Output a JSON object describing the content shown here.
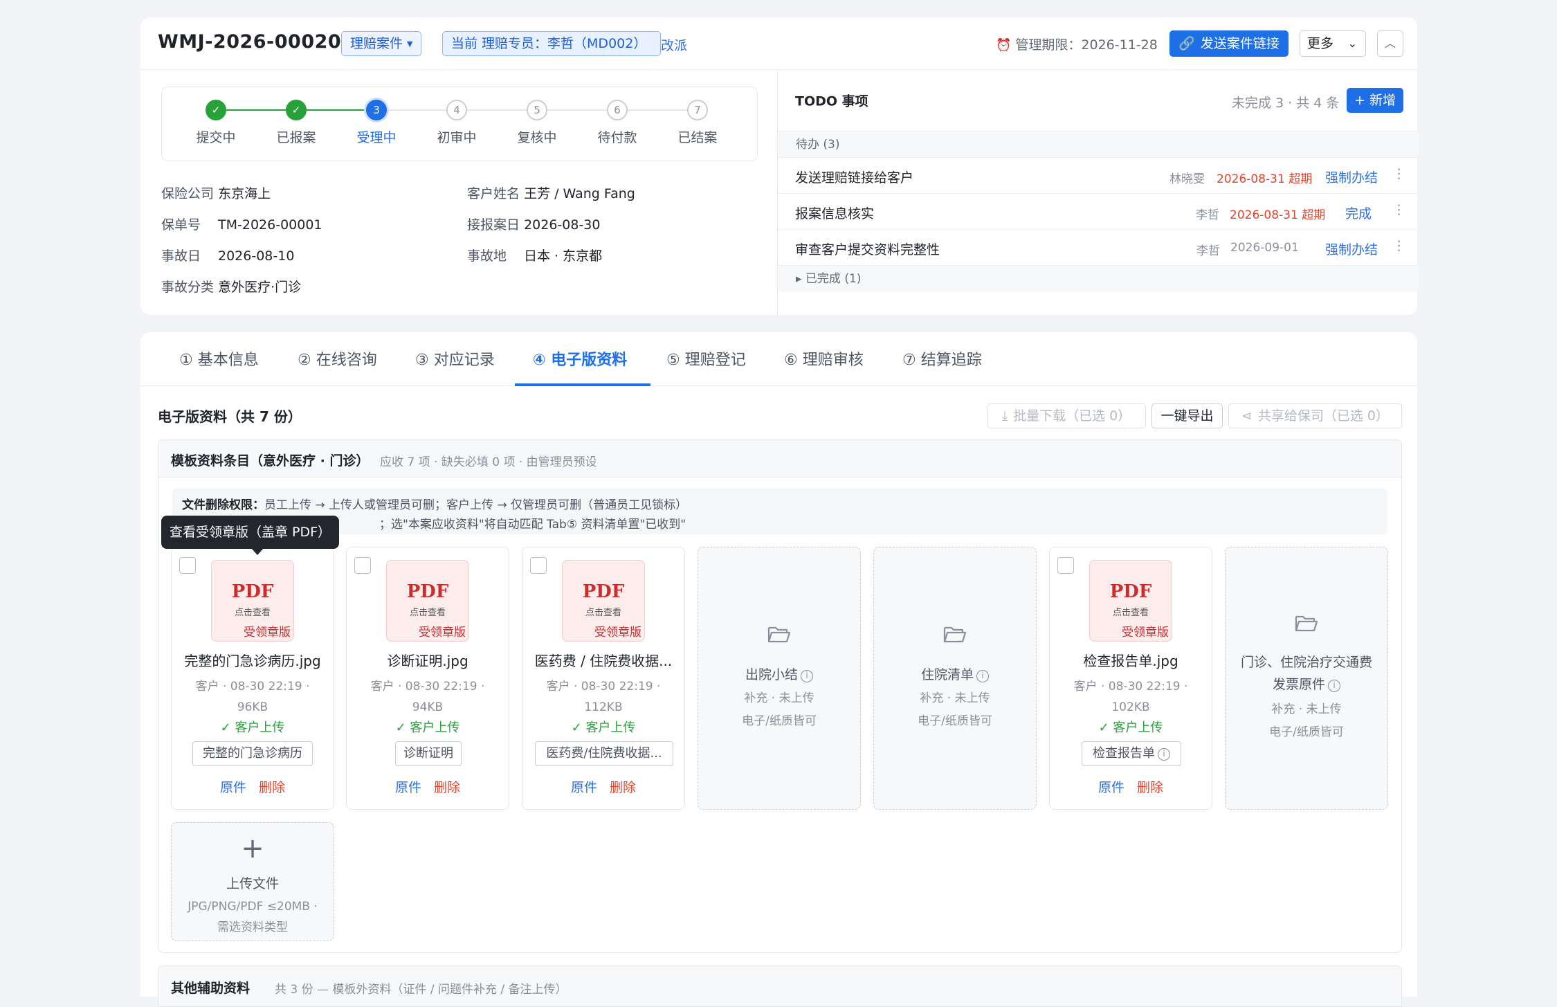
{
  "header": {
    "case_id": "WMJ-2026-00020",
    "case_type": "理赔案件",
    "agent": "当前 理赔专员：李哲（MD002）",
    "reassign": "改派",
    "deadline": "管理期限：2026-11-28",
    "send_link": "发送案件链接",
    "more": "更多"
  },
  "steps": [
    {
      "num": "1",
      "label": "提交中",
      "state": "done"
    },
    {
      "num": "2",
      "label": "已报案",
      "state": "done"
    },
    {
      "num": "3",
      "label": "受理中",
      "state": "active"
    },
    {
      "num": "4",
      "label": "初审中",
      "state": "todo"
    },
    {
      "num": "5",
      "label": "复核中",
      "state": "todo"
    },
    {
      "num": "6",
      "label": "待付款",
      "state": "todo"
    },
    {
      "num": "7",
      "label": "已结案",
      "state": "todo"
    }
  ],
  "info": {
    "insurer_k": "保险公司",
    "insurer_v": "东京海上",
    "customer_k": "客户姓名",
    "customer_v": "王芳 / Wang Fang",
    "policy_k": "保单号",
    "policy_v": "TM-2026-00001",
    "report_k": "接报案日",
    "report_v": "2026-08-30",
    "accident_k": "事故日",
    "accident_v": "2026-08-10",
    "place_k": "事故地",
    "place_v": "日本 · 东京都",
    "category_k": "事故分类",
    "category_v": "意外医疗·门诊"
  },
  "todo": {
    "title": "TODO 事项",
    "count": "未完成 3 · 共 4 条",
    "add": "+ 新增",
    "pending": "待办 (3)",
    "done": "▸ 已完成 (1)",
    "rows": [
      {
        "title": "发送理赔链接给客户",
        "who": "林晓雯",
        "date": "2026-08-31 超期",
        "action": "强制办结"
      },
      {
        "title": "报案信息核实",
        "who": "李哲",
        "date": "2026-08-31 超期",
        "action": "完成"
      },
      {
        "title": "审查客户提交资料完整性",
        "who": "李哲",
        "date": "2026-09-01",
        "action": "强制办结"
      }
    ]
  },
  "tabs": [
    "① 基本信息",
    "② 在线咨询",
    "③ 对应记录",
    "④ 电子版资料",
    "⑤ 理赔登记",
    "⑥ 理赔审核",
    "⑦ 结算追踪"
  ],
  "docs": {
    "title": "电子版资料（共 7 份）",
    "batch_download": "批量下载（已选 0）",
    "export": "一键导出",
    "share": "共享给保司（已选 0）",
    "template_title": "模板资料条目（意外医疗 · 门诊）",
    "template_meta": "应收 7 项 · 缺失必填 0 项 · 由管理员预设",
    "notice_label": "文件删除权限：",
    "notice_1": "员工上传 → 上传人或管理员可删；客户上传 → 仅管理员可删（普通员工见锁标）",
    "notice_2": "；选\"本案应收资料\"将自动匹配 Tab⑤ 资料清单置\"已收到\"",
    "tooltip": "查看受领章版（盖章 PDF）",
    "pdf_label": "PDF",
    "pdf_hint": "点击查看",
    "stamp": "受领章版",
    "original": "原件",
    "delete": "删除",
    "cards": [
      {
        "name": "完整的门急诊病历.jpg",
        "meta": "客户 · 08-30 22:19 · 96KB",
        "src": "✓ 客户上传",
        "tag": "完整的门急诊病历"
      },
      {
        "name": "诊断证明.jpg",
        "meta": "客户 · 08-30 22:19 · 94KB",
        "src": "✓ 客户上传",
        "tag": "诊断证明"
      },
      {
        "name": "医药费 / 住院费收据...",
        "meta": "客户 · 08-30 22:19 · 112KB",
        "src": "✓ 客户上传",
        "tag": "医药费/住院费收据..."
      },
      {
        "name": "检查报告单.jpg",
        "meta": "客户 · 08-30 22:19 · 102KB",
        "src": "✓ 客户上传",
        "tag": "检查报告单"
      }
    ],
    "empty": [
      {
        "name": "出院小结",
        "status": "补充 · 未上传",
        "kind": "电子/纸质皆可"
      },
      {
        "name": "住院清单",
        "status": "补充 · 未上传",
        "kind": "电子/纸质皆可"
      },
      {
        "name": "门诊、住院治疗交通费发票原件",
        "status": "补充 · 未上传",
        "kind": "电子/纸质皆可"
      }
    ],
    "upload": {
      "label": "上传文件",
      "hint": "JPG/PNG/PDF ≤20MB · 需选资料类型"
    },
    "other_title": "其他辅助资料",
    "other_meta": "共 3 份 — 模板外资料（证件 / 问题件补充 / 备注上传）"
  }
}
